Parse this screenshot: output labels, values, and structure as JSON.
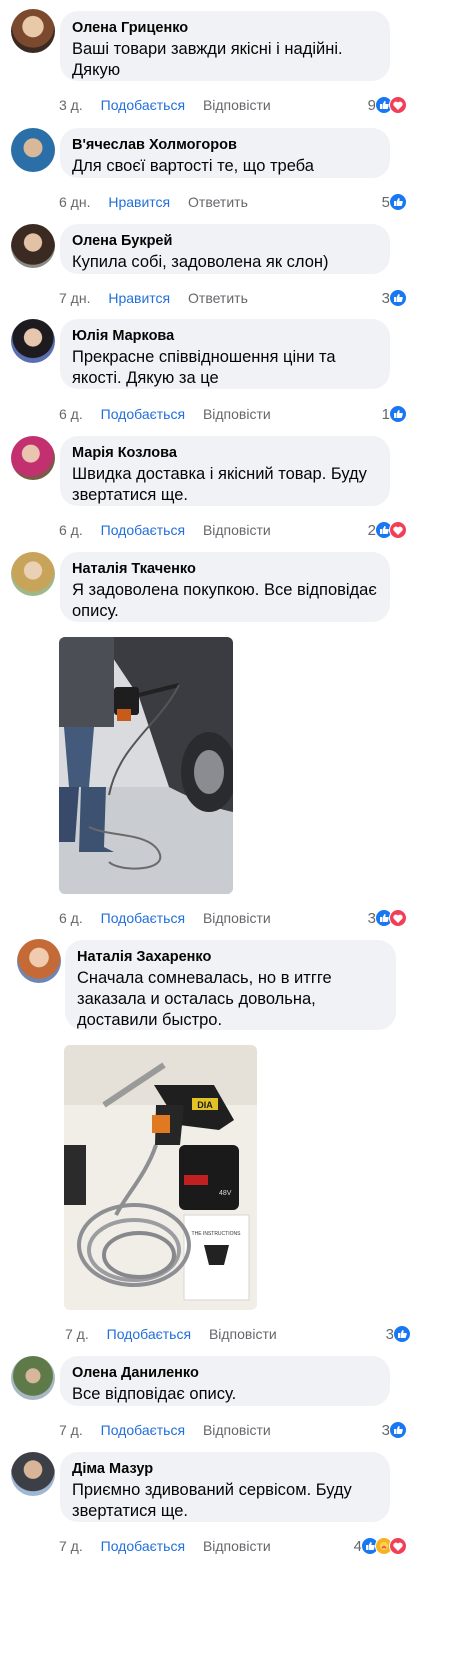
{
  "comments": [
    {
      "author": "Олена Гриценко",
      "text": "Ваші товари завжди якісні і надійні. Дякую",
      "time": "3 д.",
      "like": "Подобається",
      "reply": "Відповісти",
      "count": "9",
      "reactions": [
        "like",
        "love"
      ]
    },
    {
      "author": "В'ячеслав Холмогоров",
      "text": "Для своєї вартості те, що треба",
      "time": "6 дн.",
      "like": "Нравится",
      "reply": "Ответить",
      "count": "5",
      "reactions": [
        "like"
      ]
    },
    {
      "author": "Олена Букрей",
      "text": "Купила собі, задоволена як слон)",
      "time": "7 дн.",
      "like": "Нравится",
      "reply": "Ответить",
      "count": "3",
      "reactions": [
        "like"
      ]
    },
    {
      "author": "Юлія Маркова",
      "text": "Прекрасне співвідношення ціни та якості. Дякую за це",
      "time": "6 д.",
      "like": "Подобається",
      "reply": "Відповісти",
      "count": "1",
      "reactions": [
        "like"
      ]
    },
    {
      "author": "Марія Козлова",
      "text": "Швидка доставка і якісний товар. Буду звертатися ще.",
      "time": "6 д.",
      "like": "Подобається",
      "reply": "Відповісти",
      "count": "2",
      "reactions": [
        "like",
        "love"
      ]
    },
    {
      "author": "Наталія Ткаченко",
      "text": "Я задоволена покупкою. Все відповідає опису.",
      "time": "6 д.",
      "like": "Подобається",
      "reply": "Відповісти",
      "count": "3",
      "reactions": [
        "like",
        "love"
      ]
    },
    {
      "author": "Наталія Захаренко",
      "text": "Сначала сомневалась, но в итгге заказала и осталась довольна, доставили быстро.",
      "time": "7 д.",
      "like": "Подобається",
      "reply": "Відповісти",
      "count": "3",
      "reactions": [
        "like"
      ]
    },
    {
      "author": "Олена Даниленко",
      "text": "Все відповідає опису.",
      "time": "7 д.",
      "like": "Подобається",
      "reply": "Відповісти",
      "count": "3",
      "reactions": [
        "like"
      ]
    },
    {
      "author": "Діма Мазур",
      "text": "Приємно здивований сервісом. Буду звертатися ще.",
      "time": "7 д.",
      "like": "Подобається",
      "reply": "Відповісти",
      "count": "4",
      "reactions": [
        "like",
        "care",
        "love"
      ]
    }
  ],
  "photos": {
    "washer_in_snow": {
      "alt": "photo-car-wash"
    },
    "washer_box": {
      "brand_label": "DIA",
      "voltage_label": "48V",
      "manual_title": "THE INSTRUCTIONS"
    }
  },
  "colors": {
    "bubble": "#f0f2f5",
    "link": "#216fdb",
    "meta": "#65676b",
    "like": "#1877f2",
    "love": "#f33e58"
  }
}
